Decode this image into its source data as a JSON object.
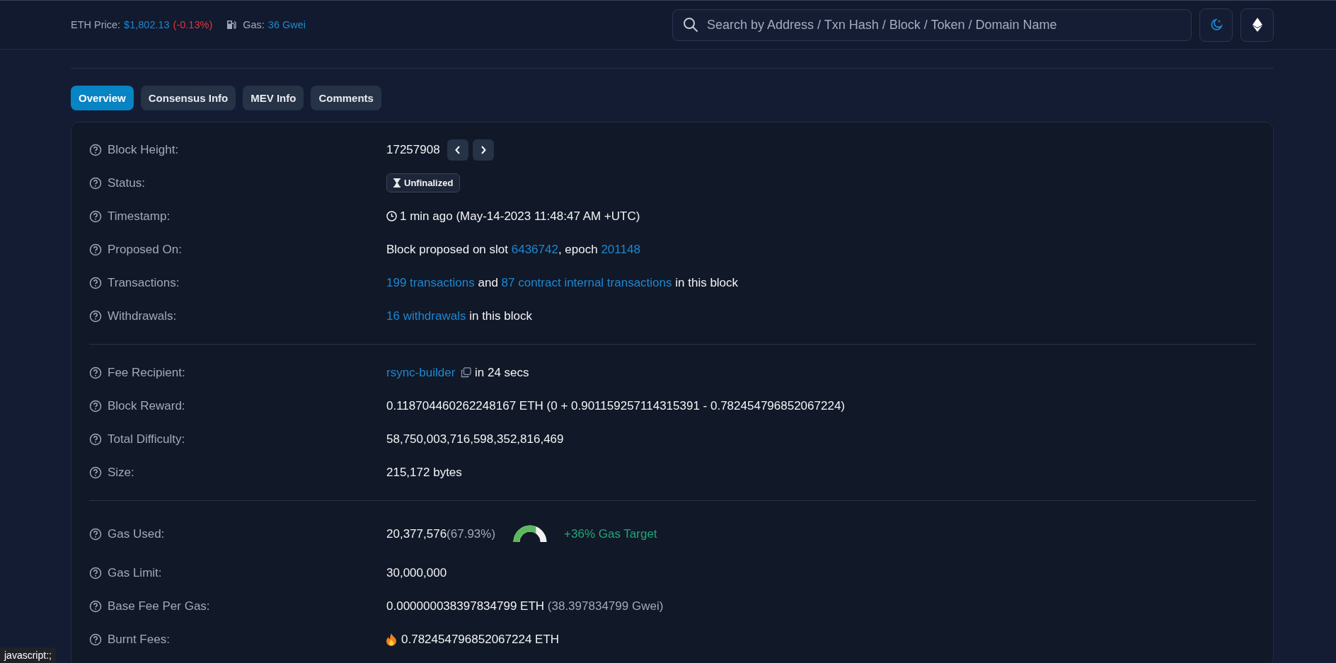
{
  "header": {
    "price_label": "ETH Price:",
    "price": "$1,802.13",
    "price_change": "(-0.13%)",
    "gas_label": "Gas:",
    "gas": "36 Gwei",
    "search": {
      "placeholder": "Search by Address / Txn Hash / Block / Token / Domain Name"
    }
  },
  "tabs": [
    {
      "label": "Overview",
      "selected": true
    },
    {
      "label": "Consensus Info",
      "selected": false
    },
    {
      "label": "MEV Info",
      "selected": false
    },
    {
      "label": "Comments",
      "selected": false
    }
  ],
  "sections": [
    {
      "rows": [
        {
          "label": "Block Height:",
          "kind": "block",
          "parts": [
            {
              "text": "17257908",
              "kind": "plain"
            }
          ]
        },
        {
          "label": "Status:",
          "kind": "status",
          "parts": [
            {
              "text": "Unfinalized",
              "kind": "plain"
            }
          ]
        },
        {
          "label": "Timestamp:",
          "kind": "time",
          "parts": [
            {
              "text": "1 min ago (May-14-2023 11:48:47 AM +UTC)",
              "kind": "plain"
            }
          ]
        },
        {
          "label": "Proposed On:",
          "kind": "plain",
          "parts": [
            {
              "text": "Block proposed on slot ",
              "kind": "plain"
            },
            {
              "text": "6436742",
              "kind": "link"
            },
            {
              "text": ", epoch ",
              "kind": "plain"
            },
            {
              "text": "201148",
              "kind": "link"
            }
          ]
        },
        {
          "label": "Transactions:",
          "kind": "plain",
          "parts": [
            {
              "text": "199 transactions",
              "kind": "link"
            },
            {
              "text": " and ",
              "kind": "plain"
            },
            {
              "text": "87 contract internal transactions",
              "kind": "link"
            },
            {
              "text": " in this block",
              "kind": "plain"
            }
          ]
        },
        {
          "label": "Withdrawals:",
          "kind": "plain",
          "parts": [
            {
              "text": "16 withdrawals",
              "kind": "link"
            },
            {
              "text": " in this block",
              "kind": "plain"
            }
          ]
        }
      ]
    },
    {
      "rows": [
        {
          "label": "Fee Recipient:",
          "kind": "copy",
          "parts": [
            {
              "text": "rsync-builder",
              "kind": "link"
            },
            {
              "text": " in 24 secs",
              "kind": "plain"
            }
          ]
        },
        {
          "label": "Block Reward:",
          "kind": "plain",
          "parts": [
            {
              "text": "0.118704460262248167 ETH (0 + 0.901159257114315391 - 0.782454796852067224)",
              "kind": "plain"
            }
          ]
        },
        {
          "label": "Total Difficulty:",
          "kind": "plain",
          "parts": [
            {
              "text": "58,750,003,716,598,352,816,469",
              "kind": "plain"
            }
          ]
        },
        {
          "label": "Size:",
          "kind": "plain",
          "parts": [
            {
              "text": "215,172 bytes",
              "kind": "plain"
            }
          ]
        }
      ]
    },
    {
      "rows": [
        {
          "label": "Gas Used:",
          "kind": "gauge",
          "level": 0.6793,
          "parts": [
            {
              "text": "20,377,576",
              "kind": "plain"
            },
            {
              "text": "(67.93%)",
              "kind": "muted"
            },
            {
              "text": "+36% Gas Target",
              "kind": "positive"
            }
          ]
        },
        {
          "label": "Gas Limit:",
          "kind": "plain",
          "parts": [
            {
              "text": "30,000,000",
              "kind": "plain"
            }
          ]
        },
        {
          "label": "Base Fee Per Gas:",
          "kind": "plain",
          "parts": [
            {
              "text": "0.000000038397834799 ETH ",
              "kind": "plain"
            },
            {
              "text": "(38.397834799 Gwei)",
              "kind": "muted"
            }
          ]
        },
        {
          "label": "Burnt Fees:",
          "kind": "burn",
          "parts": [
            {
              "text": "0.782454796852067224 ETH",
              "kind": "plain"
            }
          ]
        }
      ]
    }
  ],
  "status_bar": "javascript:;"
}
